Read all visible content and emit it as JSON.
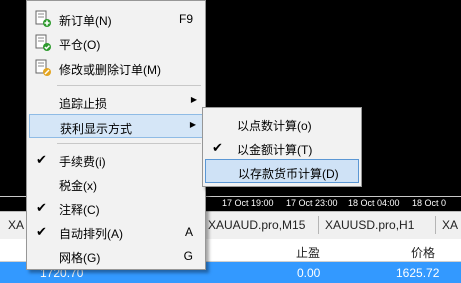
{
  "chart": {
    "time_labels": [
      "17 Oct 19:00",
      "17 Oct 23:00",
      "18 Oct 04:00",
      "18 Oct 0"
    ],
    "tabs": [
      "XA",
      "XAUAUD.pro,M15",
      "XAUUSD.pro,H1",
      "XA"
    ]
  },
  "table": {
    "headers": {
      "profit": "止盈",
      "price": "价格"
    },
    "row": {
      "left": "1720.70",
      "profit": "0.00",
      "price": "1625.72"
    }
  },
  "menu": {
    "items": [
      {
        "label": "新订单(N)",
        "shortcut": "F9",
        "icon": "new-order-icon"
      },
      {
        "label": "平仓(O)",
        "icon": "close-position-icon"
      },
      {
        "label": "修改或删除订单(M)",
        "icon": "modify-order-icon"
      },
      {
        "label": "追踪止损"
      },
      {
        "label": "获利显示方式"
      },
      {
        "label": "手续费(i)",
        "checked": true
      },
      {
        "label": "税金(x)",
        "checked": false
      },
      {
        "label": "注释(C)",
        "checked": true
      },
      {
        "label": "自动排列(A)",
        "shortcut": "A",
        "checked": true
      },
      {
        "label": "网格(G)",
        "shortcut": "G",
        "checked": false
      }
    ],
    "submenu": [
      {
        "label": "以点数计算(o)"
      },
      {
        "label": "以金额计算(T)",
        "checked": true
      },
      {
        "label": "以存款货币计算(D)"
      }
    ]
  }
}
